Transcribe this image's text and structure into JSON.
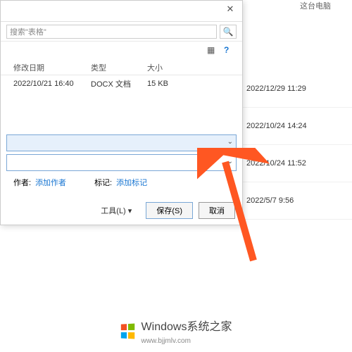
{
  "background": {
    "header_fragment": "这台电脑",
    "dates": [
      "2022/12/29 11:29",
      "2022/10/24 14:24",
      "2022/10/24 11:52",
      "2022/5/7 9:56"
    ]
  },
  "dialog": {
    "close": "✕",
    "search_placeholder": "搜索\"表格\"",
    "search_icon": "🔍",
    "view_icon": "▦",
    "help_icon": "?",
    "columns": {
      "date": "修改日期",
      "type": "类型",
      "size": "大小"
    },
    "file_row": {
      "date": "2022/10/21 16:40",
      "type": "DOCX 文档",
      "size": "15 KB"
    },
    "meta": {
      "author_label": "作者:",
      "add_author": "添加作者",
      "tag_label": "标记:",
      "add_tag": "添加标记"
    },
    "dropdown_arrow": "⌄",
    "tools_label": "工具(L)",
    "tools_arrow": "▾",
    "save_label": "保存(S)",
    "cancel_label": "取消"
  },
  "watermark": {
    "main": "Windows系统之家",
    "sub": "www.bjjmlv.com"
  }
}
